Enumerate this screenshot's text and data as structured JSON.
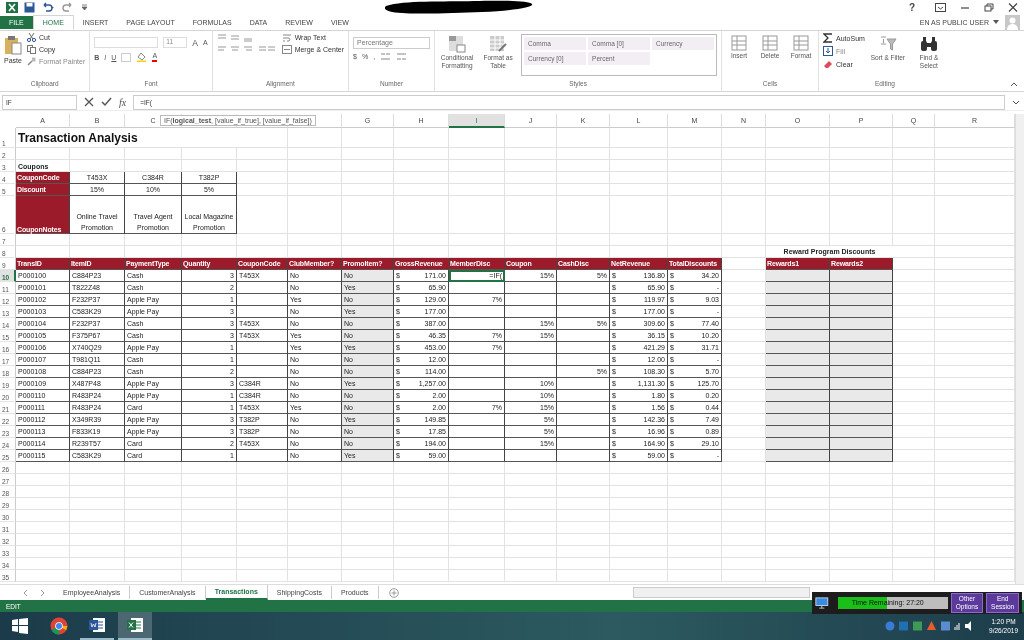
{
  "title_bar": {
    "help": "?"
  },
  "account": {
    "user": "EN AS PUBLIC USER"
  },
  "ribbon_tabs": [
    {
      "label": "FILE",
      "kind": "file",
      "selected": false
    },
    {
      "label": "HOME",
      "kind": "tab",
      "selected": true
    },
    {
      "label": "INSERT",
      "kind": "tab",
      "selected": false
    },
    {
      "label": "PAGE LAYOUT",
      "kind": "tab",
      "selected": false
    },
    {
      "label": "FORMULAS",
      "kind": "tab",
      "selected": false
    },
    {
      "label": "DATA",
      "kind": "tab",
      "selected": false
    },
    {
      "label": "REVIEW",
      "kind": "tab",
      "selected": false
    },
    {
      "label": "VIEW",
      "kind": "tab",
      "selected": false
    }
  ],
  "clipboard": {
    "paste": "Paste",
    "cut": "Cut",
    "copy": "Copy",
    "format_painter": "Format Painter",
    "label": "Clipboard"
  },
  "font": {
    "size": "11",
    "grow": "A",
    "shrink": "A",
    "styles": [
      "B",
      "I",
      "U"
    ],
    "font_color": "A",
    "label": "Font"
  },
  "alignment": {
    "wrap_text": "Wrap Text",
    "merge": "Merge & Center",
    "label": "Alignment"
  },
  "number": {
    "format": "Percentage",
    "symbols": [
      "$",
      "%",
      ","
    ],
    "label": "Number"
  },
  "styles": {
    "conditional": "Conditional Formatting",
    "format_table": "Format as Table",
    "gallery": [
      "Comma",
      "Comma [0]",
      "Currency",
      "Currency [0]",
      "Percent"
    ],
    "label": "Styles"
  },
  "cells": {
    "buttons": [
      "Insert",
      "Delete",
      "Format"
    ],
    "label": "Cells"
  },
  "editing": {
    "autosum": "AutoSum",
    "fill": "Fill",
    "clear": "Clear",
    "sort": "Sort & Filter",
    "find": "Find & Select",
    "label": "Editing"
  },
  "formula_bar": {
    "name_box": "IF",
    "fx": "fx",
    "formula": "=IF(",
    "tooltip": "IF(**logical_test**, [value_if_true], [value_if_false])"
  },
  "sheet": {
    "column_headers": [
      {
        "label": "A",
        "selected": false
      },
      {
        "label": "B",
        "selected": false
      },
      {
        "label": "C",
        "selected": false
      },
      {
        "selected": false
      },
      {
        "selected": false
      },
      {
        "selected": false
      },
      {
        "label": "G",
        "selected": false
      },
      {
        "label": "H",
        "selected": false
      },
      {
        "label": "I",
        "selected": true
      },
      {
        "label": "J",
        "selected": false
      },
      {
        "label": "K",
        "selected": false
      },
      {
        "label": "L",
        "selected": false
      },
      {
        "label": "M",
        "selected": false
      },
      {
        "label": "N",
        "selected": false
      },
      {
        "label": "O",
        "selected": false
      },
      {
        "label": "P",
        "selected": false
      },
      {
        "label": "Q",
        "selected": false
      },
      {
        "label": "R",
        "selected": false
      }
    ],
    "row_headers": [
      {
        "label": "1",
        "selected": false
      },
      {
        "label": "2",
        "selected": false
      },
      {
        "label": "3",
        "selected": false
      },
      {
        "label": "4",
        "selected": false
      },
      {
        "label": "5",
        "selected": false
      },
      {
        "label": "6",
        "selected": false
      },
      {
        "label": "7",
        "selected": false
      },
      {
        "label": "8",
        "selected": false
      },
      {
        "label": "9",
        "selected": false
      },
      {
        "label": "10",
        "selected": true
      },
      {
        "label": "11",
        "selected": false
      },
      {
        "label": "12",
        "selected": false
      },
      {
        "label": "13",
        "selected": false
      },
      {
        "label": "14",
        "selected": false
      },
      {
        "label": "15",
        "selected": false
      },
      {
        "label": "16",
        "selected": false
      },
      {
        "label": "17",
        "selected": false
      },
      {
        "label": "18",
        "selected": false
      },
      {
        "label": "19",
        "selected": false
      },
      {
        "label": "20",
        "selected": false
      },
      {
        "label": "21",
        "selected": false
      },
      {
        "label": "22",
        "selected": false
      },
      {
        "label": "23",
        "selected": false
      },
      {
        "label": "24",
        "selected": false
      },
      {
        "label": "25",
        "selected": false
      },
      {
        "label": "26",
        "selected": false
      },
      {
        "label": "27",
        "selected": false
      },
      {
        "label": "28",
        "selected": false
      },
      {
        "label": "29",
        "selected": false
      },
      {
        "label": "30",
        "selected": false
      },
      {
        "label": "31",
        "selected": false
      },
      {
        "label": "32",
        "selected": false
      },
      {
        "label": "33",
        "selected": false
      },
      {
        "label": "34",
        "selected": false
      },
      {
        "label": "35",
        "selected": false
      }
    ],
    "title": "Transaction Analysis",
    "coupons": {
      "label": "Coupons",
      "rows": [
        {
          "header": "CouponCode",
          "values": [
            "T453X",
            "C384R",
            "T382P"
          ]
        },
        {
          "header": "Discount",
          "values": [
            "15%",
            "10%",
            "5%"
          ]
        },
        {
          "header": "CouponNotes",
          "values": [
            "Online Travel Promotion",
            "Travel Agent Promotion",
            "Local Magazine Promotion"
          ]
        }
      ]
    },
    "rewards": {
      "title": "Reward Program Discounts",
      "headers": [
        "Rewards1",
        "Rewards2"
      ]
    },
    "transactions": {
      "columns": [
        "TransID",
        "ItemID",
        "PaymentType",
        "Quantity",
        "CouponCode",
        "ClubMember?",
        "PromoItem?",
        "GrossRevenue",
        "MemberDisc",
        "Coupon",
        "CashDisc",
        "NetRevenue",
        "TotalDiscounts"
      ],
      "rows": [
        [
          "P000100",
          "C884P23",
          "Cash",
          "3",
          "T453X",
          "No",
          "No",
          [
            "$",
            "171.00"
          ],
          "=IF(",
          "15%",
          "5%",
          [
            "$",
            "136.80"
          ],
          [
            "$",
            "34.20"
          ]
        ],
        [
          "P000101",
          "T822Z48",
          "Cash",
          "2",
          null,
          "No",
          "Yes",
          [
            "$",
            "65.90"
          ],
          null,
          null,
          null,
          [
            "$",
            "65.90"
          ],
          [
            "$",
            "-"
          ]
        ],
        [
          "P000102",
          "F232P37",
          "Apple Pay",
          "1",
          null,
          "Yes",
          "No",
          [
            "$",
            "129.00"
          ],
          "7%",
          null,
          null,
          [
            "$",
            "119.97"
          ],
          [
            "$",
            "9.03"
          ]
        ],
        [
          "P000103",
          "C583K29",
          "Apple Pay",
          "3",
          null,
          "No",
          "Yes",
          [
            "$",
            "177.00"
          ],
          null,
          null,
          null,
          [
            "$",
            "177.00"
          ],
          [
            "$",
            "-"
          ]
        ],
        [
          "P000104",
          "F232P37",
          "Cash",
          "3",
          "T453X",
          "No",
          "No",
          [
            "$",
            "387.00"
          ],
          null,
          "15%",
          "5%",
          [
            "$",
            "309.60"
          ],
          [
            "$",
            "77.40"
          ]
        ],
        [
          "P000105",
          "F375P67",
          "Cash",
          "3",
          "T453X",
          "Yes",
          "No",
          [
            "$",
            "46.35"
          ],
          "7%",
          "15%",
          null,
          [
            "$",
            "36.15"
          ],
          [
            "$",
            "10.20"
          ]
        ],
        [
          "P000106",
          "X740Q29",
          "Apple Pay",
          "1",
          null,
          "Yes",
          "Yes",
          [
            "$",
            "453.00"
          ],
          "7%",
          null,
          null,
          [
            "$",
            "421.29"
          ],
          [
            "$",
            "31.71"
          ]
        ],
        [
          "P000107",
          "T981Q11",
          "Cash",
          "1",
          null,
          "No",
          "No",
          [
            "$",
            "12.00"
          ],
          null,
          null,
          null,
          [
            "$",
            "12.00"
          ],
          [
            "$",
            "-"
          ]
        ],
        [
          "P000108",
          "C884P23",
          "Cash",
          "2",
          null,
          "No",
          "No",
          [
            "$",
            "114.00"
          ],
          null,
          null,
          "5%",
          [
            "$",
            "108.30"
          ],
          [
            "$",
            "5.70"
          ]
        ],
        [
          "P000109",
          "X487P48",
          "Apple Pay",
          "3",
          "C384R",
          "No",
          "Yes",
          [
            "$",
            "1,257.00"
          ],
          null,
          "10%",
          null,
          [
            "$",
            "1,131.30"
          ],
          [
            "$",
            "125.70"
          ]
        ],
        [
          "P000110",
          "R483P24",
          "Apple Pay",
          "1",
          "C384R",
          "No",
          "No",
          [
            "$",
            "2.00"
          ],
          null,
          "10%",
          null,
          [
            "$",
            "1.80"
          ],
          [
            "$",
            "0.20"
          ]
        ],
        [
          "P000111",
          "R483P24",
          "Card",
          "1",
          "T453X",
          "Yes",
          "No",
          [
            "$",
            "2.00"
          ],
          "7%",
          "15%",
          null,
          [
            "$",
            "1.56"
          ],
          [
            "$",
            "0.44"
          ]
        ],
        [
          "P000112",
          "X349R39",
          "Apple Pay",
          "3",
          "T382P",
          "No",
          "Yes",
          [
            "$",
            "149.85"
          ],
          null,
          "5%",
          null,
          [
            "$",
            "142.36"
          ],
          [
            "$",
            "7.49"
          ]
        ],
        [
          "P000113",
          "F833K19",
          "Apple Pay",
          "3",
          "T382P",
          "No",
          "No",
          [
            "$",
            "17.85"
          ],
          null,
          "5%",
          null,
          [
            "$",
            "16.96"
          ],
          [
            "$",
            "0.89"
          ]
        ],
        [
          "P000114",
          "R239T57",
          "Card",
          "2",
          "T453X",
          "No",
          "No",
          [
            "$",
            "194.00"
          ],
          null,
          "15%",
          null,
          [
            "$",
            "164.90"
          ],
          [
            "$",
            "29.10"
          ]
        ],
        [
          "P000115",
          "C583K29",
          "Card",
          "1",
          null,
          "No",
          "Yes",
          [
            "$",
            "59.00"
          ],
          null,
          null,
          null,
          [
            "$",
            "59.00"
          ],
          [
            "$",
            "-"
          ]
        ]
      ]
    }
  },
  "sheet_tabs": [
    {
      "label": "EmployeeAnalysis",
      "selected": false
    },
    {
      "label": "CustomerAnalysis",
      "selected": false
    },
    {
      "label": "Transactions",
      "selected": true
    },
    {
      "label": "ShippingCosts",
      "selected": false
    },
    {
      "label": "Products",
      "selected": false
    }
  ],
  "status_bar": {
    "mode": "EDIT"
  },
  "exam_timer": {
    "text": "Time Remaining: 27:20",
    "level": 0.45,
    "buttons": [
      "Other Options",
      "End Session"
    ]
  },
  "taskbar": {
    "time": "1:20 PM",
    "date": "9/26/2019"
  }
}
